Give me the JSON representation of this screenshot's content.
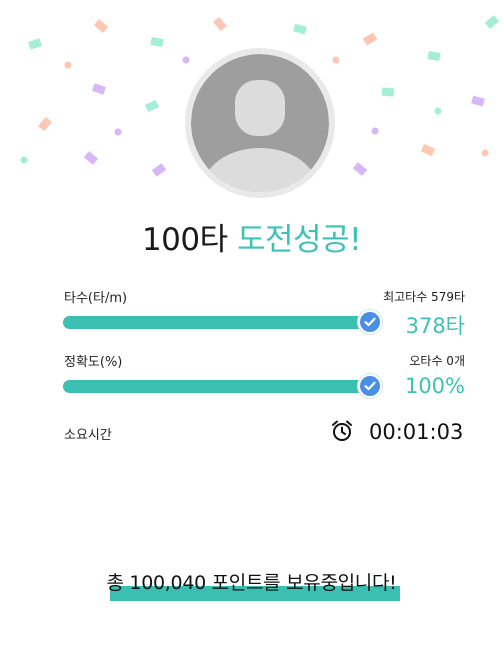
{
  "colors": {
    "accent": "#3cc3b6",
    "bar": "#3bbfb1",
    "check": "#4a90e2"
  },
  "result": {
    "headline_count": "100타",
    "headline_status": "도전성공!"
  },
  "stats": {
    "speed": {
      "label": "타수(타/m)",
      "side": "최고타수 579타",
      "value": "378타",
      "progress": 1.0
    },
    "accuracy": {
      "label": "정확도(%)",
      "side": "오타수 0개",
      "value": "100%",
      "progress": 1.0
    },
    "time": {
      "label": "소요시간",
      "icon": "alarm-clock-icon",
      "value": "00:01:03"
    }
  },
  "footer": {
    "message": "총 100,040 포인트를 보유중입니다!"
  }
}
